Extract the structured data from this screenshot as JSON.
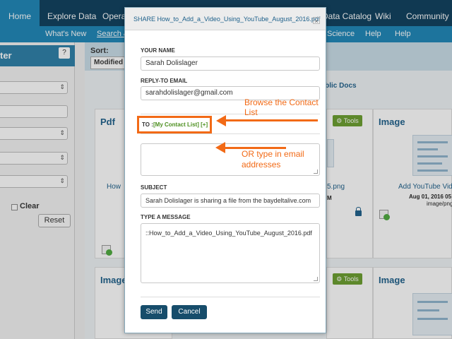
{
  "topnav": {
    "items": [
      "Home",
      "Explore Data",
      "Operat",
      "Data Catalog",
      "Wiki",
      "Community"
    ]
  },
  "subnav": {
    "items": [
      "What's New",
      "Search &",
      "Science",
      "Help",
      "Help"
    ]
  },
  "filter_panel": {
    "title": "ter",
    "help_label": "?",
    "clear_label": "Clear",
    "reset_label": "Reset"
  },
  "sort": {
    "label": "Sort:",
    "value": "Modified"
  },
  "main": {
    "public_docs": "ublic Docs",
    "cards": [
      {
        "title": "Pdf",
        "link": "How"
      },
      {
        "link": "5.png",
        "meta": "M"
      },
      {
        "title": "Image",
        "link": "Add YouTube Vid",
        "meta": "Aug 01, 2016 05",
        "type": "image/png"
      },
      {
        "title": "Image"
      },
      {
        "title": "Image"
      }
    ],
    "tools_label": "Tools"
  },
  "modal": {
    "title": "SHARE How_to_Add_a_Video_Using_YouTube_August_2016.pdf",
    "close_label": "×",
    "your_name_label": "YOUR NAME",
    "your_name_value": "Sarah Dolislager",
    "reply_label": "REPLY-TO EMAIL",
    "reply_value": "sarahdolislager@gmail.com",
    "to_label": "TO :",
    "to_link": "[My Contact List] [+]",
    "subject_label": "SUBJECT",
    "subject_value": "Sarah Dolislager is sharing a file from the baydeltalive.com",
    "message_label": "TYPE A MESSAGE",
    "message_value": "::How_to_Add_a_Video_Using_YouTube_August_2016.pdf",
    "send_label": "Send",
    "cancel_label": "Cancel"
  },
  "annotations": {
    "browse": "Browse the Contact List",
    "ortype": "OR type in email addresses"
  },
  "colors": {
    "nav_dark": "#0c3d5c",
    "nav_blue": "#1b86b8",
    "accent_orange": "#f26a16",
    "tools_green": "#6a9e2d",
    "button_dark": "#174d6b"
  }
}
